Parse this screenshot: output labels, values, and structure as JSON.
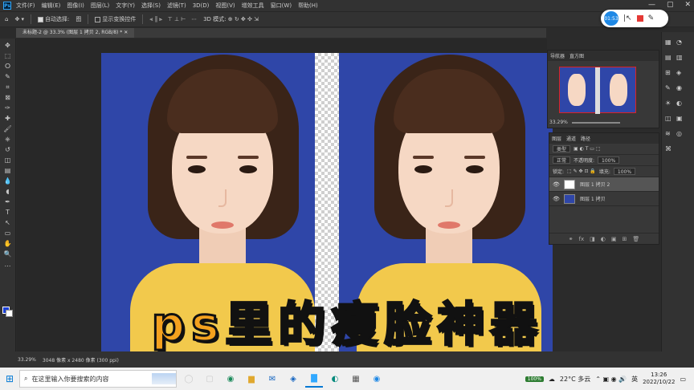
{
  "menubar": {
    "app_icon": "Ps",
    "items": [
      "文件(F)",
      "编辑(E)",
      "图像(I)",
      "图层(L)",
      "文字(Y)",
      "选择(S)",
      "滤镜(T)",
      "3D(D)",
      "视图(V)",
      "增效工具",
      "窗口(W)",
      "帮助(H)"
    ],
    "win_controls": [
      "—",
      "▢",
      "✕"
    ]
  },
  "optionsbar": {
    "auto_select_label": "自动选择:",
    "auto_select_value": "图",
    "show_transform_label": "显示变换控件"
  },
  "recorder": {
    "time": "01:53"
  },
  "document_tab": {
    "label": "未标题-2 @ 33.3% (图层 1 拷贝 2, RGB/8) *"
  },
  "toolbar": {
    "icons": [
      "move-icon",
      "marquee-icon",
      "lasso-icon",
      "quick-select-icon",
      "crop-icon",
      "frame-icon",
      "eyedropper-icon",
      "heal-icon",
      "brush-icon",
      "stamp-icon",
      "history-brush-icon",
      "eraser-icon",
      "gradient-icon",
      "blur-icon",
      "dodge-icon",
      "pen-icon",
      "type-icon",
      "path-select-icon",
      "shape-icon",
      "hand-icon",
      "zoom-icon",
      "more-icon"
    ],
    "glyphs": [
      "✥",
      "⬚",
      "ⵔ",
      "✎",
      "⌗",
      "⊠",
      "✑",
      "✚",
      "🖌",
      "⎈",
      "↺",
      "◫",
      "▤",
      "💧",
      "◖",
      "✒",
      "T",
      "↖",
      "▭",
      "✋",
      "🔍",
      "…"
    ]
  },
  "overlay_text": "ps里的瘦脸神器",
  "navigator": {
    "tabs": [
      "导航器",
      "直方图"
    ],
    "zoom": "33.29%"
  },
  "layers": {
    "tabs": [
      "图层",
      "通道",
      "路径"
    ],
    "filter_label": "类型",
    "blend_mode": "正常",
    "opacity_label": "不透明度:",
    "opacity_value": "100%",
    "lock_label": "锁定:",
    "fill_label": "填充:",
    "fill_value": "100%",
    "items": [
      {
        "name": "图层 1 拷贝 2",
        "selected": true
      },
      {
        "name": "图层 1 拷贝",
        "selected": false
      }
    ],
    "footer_icons": [
      "link-icon",
      "fx-icon",
      "mask-icon",
      "adjust-icon",
      "folder-icon",
      "new-layer-icon",
      "trash-icon"
    ],
    "footer_glyphs": [
      "⚭",
      "fx",
      "◨",
      "◐",
      "▣",
      "⊞",
      "🗑"
    ]
  },
  "statusbar": {
    "zoom": "33.29%",
    "info": "3048 像素 x 2480 像素 (300 ppi)"
  },
  "taskbar": {
    "search_placeholder": "在这里输入你要搜索的内容",
    "weather": "22°C 多云",
    "battery": "100%",
    "ime": "英",
    "time": "13:26",
    "date": "2022/10/22"
  },
  "colors": {
    "bg_blue": "#2f46a8",
    "overlay_text": "#f4a11e",
    "shirt": "#f2c94c"
  }
}
